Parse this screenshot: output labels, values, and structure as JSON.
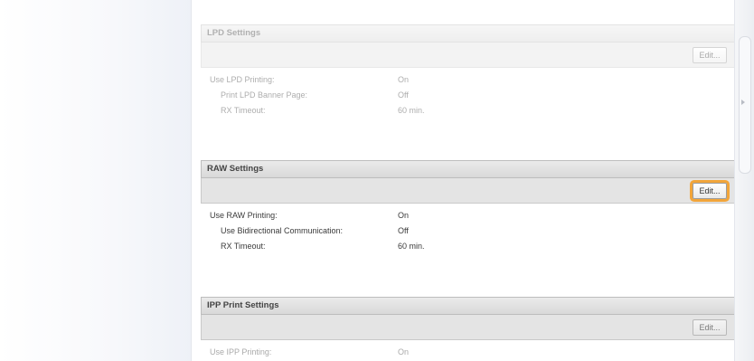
{
  "colors": {
    "highlight": "#f2a53a",
    "section_header_bg": "#dcdcdc",
    "toolbar_bg": "#e4e4e4"
  },
  "sections": {
    "lpd": {
      "title": "LPD Settings",
      "edit_label": "Edit...",
      "rows": [
        {
          "label": "Use LPD Printing:",
          "value": "On"
        },
        {
          "label": "Print LPD Banner Page:",
          "value": "Off"
        },
        {
          "label": "RX Timeout:",
          "value": "60 min."
        }
      ]
    },
    "raw": {
      "title": "RAW Settings",
      "edit_label": "Edit...",
      "rows": [
        {
          "label": "Use RAW Printing:",
          "value": "On"
        },
        {
          "label": "Use Bidirectional Communication:",
          "value": "Off"
        },
        {
          "label": "RX Timeout:",
          "value": "60 min."
        }
      ]
    },
    "ipp": {
      "title": "IPP Print Settings",
      "edit_label": "Edit...",
      "rows": [
        {
          "label": "Use IPP Printing:",
          "value": "On"
        }
      ]
    }
  }
}
